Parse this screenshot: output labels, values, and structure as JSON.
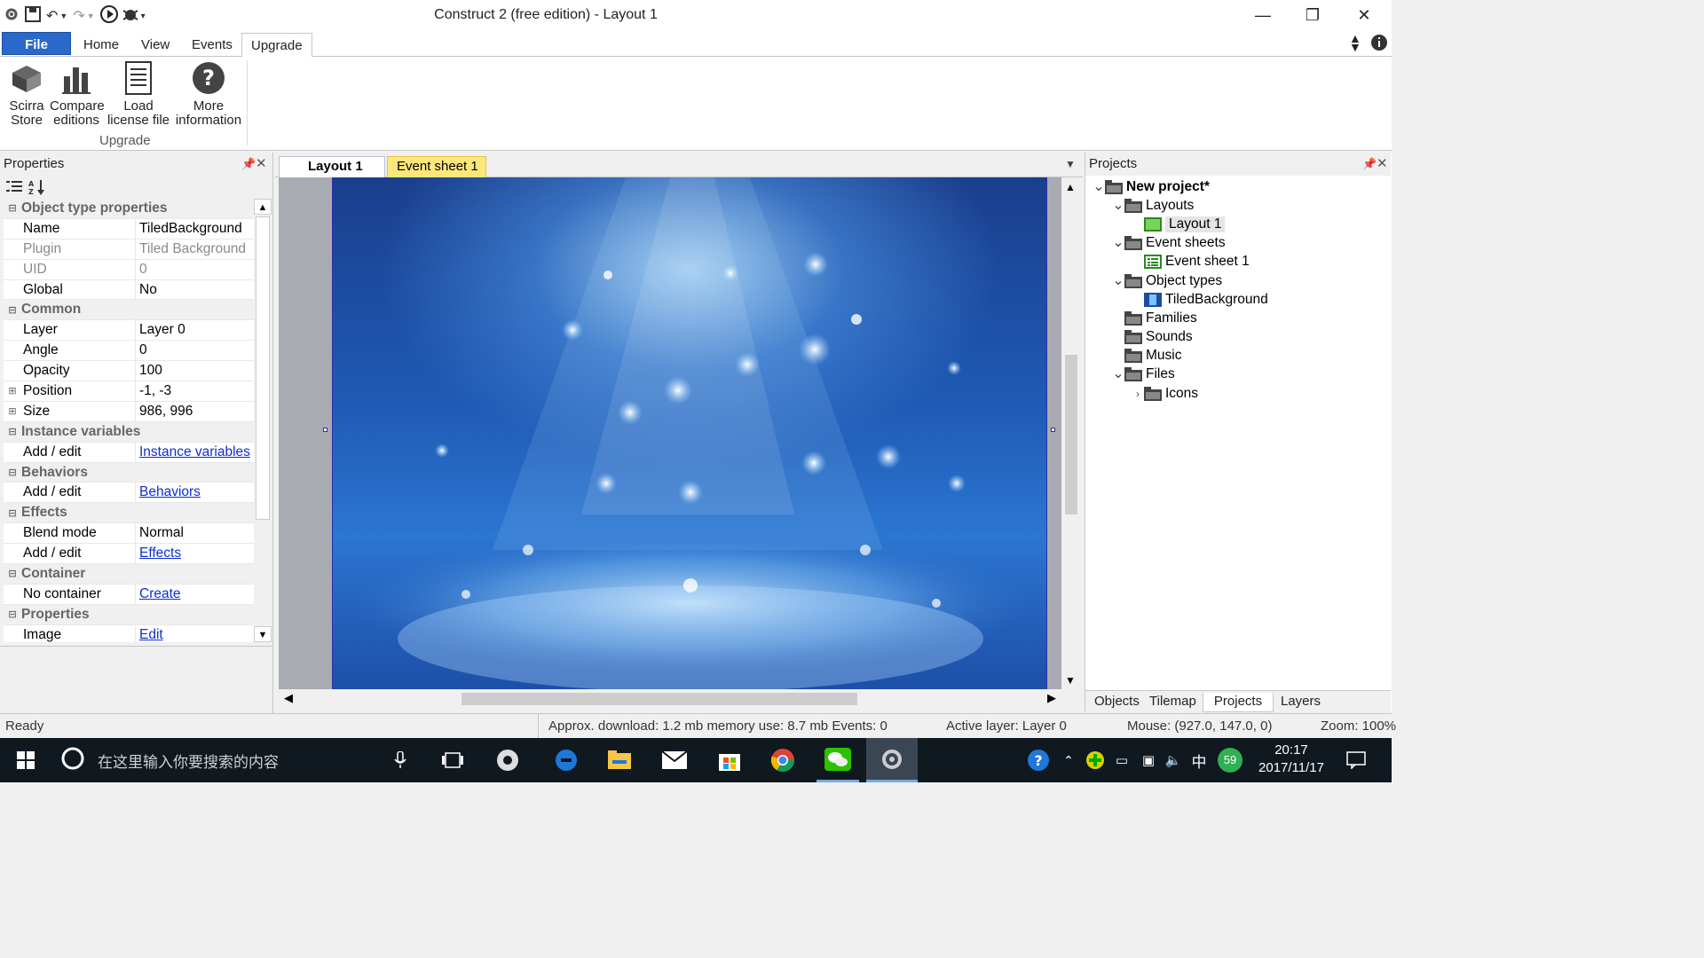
{
  "window": {
    "title": "Construct 2  (free edition) - Layout 1",
    "minimize_glyph": "—",
    "restore_glyph": "❐",
    "close_glyph": "✕"
  },
  "quick_access": [
    "gear-icon",
    "save-icon",
    "undo-icon",
    "redo-icon",
    "run-icon",
    "debug-icon"
  ],
  "ribbon": {
    "tabs": [
      {
        "label": "File"
      },
      {
        "label": "Home"
      },
      {
        "label": "View"
      },
      {
        "label": "Events"
      },
      {
        "label": "Upgrade"
      }
    ],
    "buttons": [
      {
        "line1": "Scirra",
        "line2": "Store",
        "icon": "store-icon"
      },
      {
        "line1": "Compare",
        "line2": "editions",
        "icon": "bar-chart-icon"
      },
      {
        "line1": "Load",
        "line2": "license file",
        "icon": "document-icon"
      },
      {
        "line1": "More",
        "line2": "information",
        "icon": "help-icon"
      }
    ],
    "group_label": "Upgrade"
  },
  "properties": {
    "title": "Properties",
    "rows": [
      {
        "type": "section",
        "label": "Object type properties"
      },
      {
        "type": "prop",
        "key": "Name",
        "value": "TiledBackground"
      },
      {
        "type": "prop",
        "key": "Plugin",
        "value": "Tiled Background",
        "dim": true
      },
      {
        "type": "prop",
        "key": "UID",
        "value": "0",
        "dim": true
      },
      {
        "type": "prop",
        "key": "Global",
        "value": "No"
      },
      {
        "type": "section",
        "label": "Common"
      },
      {
        "type": "prop",
        "key": "Layer",
        "value": "Layer 0"
      },
      {
        "type": "prop",
        "key": "Angle",
        "value": "0"
      },
      {
        "type": "prop",
        "key": "Opacity",
        "value": "100"
      },
      {
        "type": "prop",
        "key": "Position",
        "value": "-1, -3",
        "expandable": true
      },
      {
        "type": "prop",
        "key": "Size",
        "value": "986, 996",
        "expandable": true
      },
      {
        "type": "section",
        "label": "Instance variables"
      },
      {
        "type": "prop",
        "key": "Add / edit",
        "value": "Instance variables",
        "link": true
      },
      {
        "type": "section",
        "label": "Behaviors"
      },
      {
        "type": "prop",
        "key": "Add / edit",
        "value": "Behaviors",
        "link": true
      },
      {
        "type": "section",
        "label": "Effects"
      },
      {
        "type": "prop",
        "key": "Blend mode",
        "value": "Normal"
      },
      {
        "type": "prop",
        "key": "Add / edit",
        "value": "Effects",
        "link": true
      },
      {
        "type": "section",
        "label": "Container"
      },
      {
        "type": "prop",
        "key": "No container",
        "value": "Create",
        "link": true
      },
      {
        "type": "section",
        "label": "Properties"
      },
      {
        "type": "prop",
        "key": "Image",
        "value": "Edit",
        "link": true
      }
    ]
  },
  "document_tabs": {
    "layout_tab": "Layout 1",
    "event_tab": "Event sheet 1"
  },
  "projects": {
    "title": "Projects",
    "tree": [
      {
        "depth": 0,
        "arrow": "down",
        "icon": "folder-icon",
        "label": "New project*",
        "bold": true
      },
      {
        "depth": 1,
        "arrow": "down",
        "icon": "folder-icon",
        "label": "Layouts"
      },
      {
        "depth": 2,
        "arrow": "",
        "icon": "layout-icon",
        "label": "Layout 1",
        "selected": true
      },
      {
        "depth": 1,
        "arrow": "down",
        "icon": "folder-icon",
        "label": "Event sheets"
      },
      {
        "depth": 2,
        "arrow": "",
        "icon": "event-sheet-icon",
        "label": "Event sheet 1"
      },
      {
        "depth": 1,
        "arrow": "down",
        "icon": "folder-icon",
        "label": "Object types"
      },
      {
        "depth": 2,
        "arrow": "",
        "icon": "tiled-bg-icon",
        "label": "TiledBackground"
      },
      {
        "depth": 1,
        "arrow": "",
        "icon": "folder-icon",
        "label": "Families"
      },
      {
        "depth": 1,
        "arrow": "",
        "icon": "folder-icon",
        "label": "Sounds"
      },
      {
        "depth": 1,
        "arrow": "",
        "icon": "folder-icon",
        "label": "Music"
      },
      {
        "depth": 1,
        "arrow": "down",
        "icon": "folder-icon",
        "label": "Files"
      },
      {
        "depth": 2,
        "arrow": "right",
        "icon": "folder-icon",
        "label": "Icons"
      }
    ],
    "bottom_tabs": [
      {
        "label": "Objects"
      },
      {
        "label": "Tilemap"
      },
      {
        "label": "Projects",
        "active": true
      },
      {
        "label": "Layers"
      }
    ]
  },
  "status": {
    "ready": "Ready",
    "download": "Approx. download: 1.2 mb  memory use: 8.7 mb  Events: 0",
    "active_layer": "Active layer: Layer 0",
    "mouse": "Mouse: (927.0, 147.0, 0)",
    "zoom": "Zoom: 100%"
  },
  "taskbar": {
    "search_placeholder": "在这里输入你要搜索的内容",
    "time": "20:17",
    "date": "2017/11/17",
    "ime": "中",
    "badge": "59",
    "apps": [
      "windows-start-icon",
      "cortana-icon",
      "microphone-icon",
      "task-view-icon",
      "app-icon",
      "edge-icon",
      "file-explorer-icon",
      "mail-icon",
      "store-icon",
      "chrome-icon",
      "wechat-icon",
      "construct-icon"
    ]
  },
  "colors": {
    "accent": "#2a68c9",
    "event_tab": "#ffe87a",
    "link": "#0b2fd2",
    "taskbar": "#101820"
  }
}
